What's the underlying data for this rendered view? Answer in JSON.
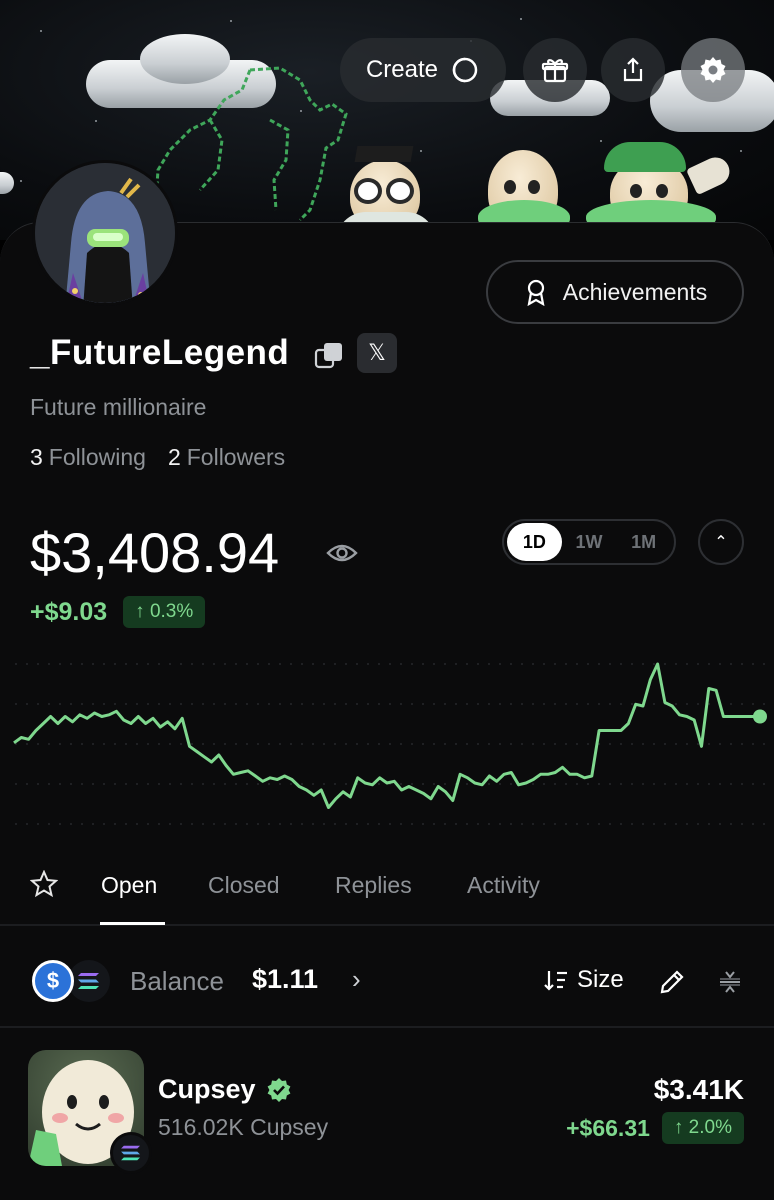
{
  "header": {
    "create_label": "Create"
  },
  "profile": {
    "username": "_FutureLegend",
    "bio": "Future millionaire",
    "following_count": "3",
    "following_label": "Following",
    "followers_count": "2",
    "followers_label": "Followers",
    "achievements_label": "Achievements",
    "x_badge": "𝕏"
  },
  "portfolio": {
    "value": "$3,408.94",
    "change_amount": "+$9.03",
    "change_percent": "↑ 0.3%",
    "ranges": [
      "1D",
      "1W",
      "1M"
    ],
    "active_range": "1D",
    "collapse_icon": "⌃"
  },
  "chart_data": {
    "type": "line",
    "title": "",
    "xlabel": "",
    "ylabel": "",
    "ylim": [
      0,
      100
    ],
    "values": [
      47,
      50,
      49,
      54,
      58,
      62,
      58,
      62,
      59,
      63,
      61,
      64,
      62,
      63,
      65,
      60,
      58,
      62,
      58,
      61,
      56,
      59,
      55,
      61,
      45,
      42,
      39,
      36,
      40,
      34,
      29,
      30,
      31,
      28,
      25,
      27,
      26,
      28,
      26,
      22,
      20,
      17,
      20,
      10,
      15,
      19,
      16,
      27,
      24,
      23,
      27,
      24,
      25,
      20,
      22,
      20,
      18,
      15,
      22,
      19,
      14,
      29,
      27,
      24,
      23,
      28,
      25,
      29,
      30,
      23,
      24,
      26,
      29,
      29,
      30,
      33,
      29,
      29,
      27,
      28,
      54,
      54,
      54,
      54,
      58,
      69,
      68,
      83,
      92,
      70,
      68,
      63,
      62,
      60,
      45,
      78,
      77,
      62,
      62,
      62,
      62,
      62,
      62
    ],
    "series": [
      {
        "values": []
      }
    ],
    "accent_color": "#7fd88e"
  },
  "tabs": [
    {
      "label": "Open",
      "active": true
    },
    {
      "label": "Closed",
      "active": false
    },
    {
      "label": "Replies",
      "active": false
    },
    {
      "label": "Activity",
      "active": false
    }
  ],
  "balance_row": {
    "label": "Balance",
    "value": "$1.11",
    "chevron": "›",
    "sort_label": "Size",
    "usdc_symbol": "$"
  },
  "holdings": [
    {
      "name": "Cupsey",
      "amount": "516.02K Cupsey",
      "value": "$3.41K",
      "change_amount": "+$66.31",
      "change_percent": "↑ 2.0%"
    }
  ],
  "colors": {
    "accent_green": "#7fd88e",
    "background": "#0b0b0c",
    "muted_text": "#8e9297",
    "usdc_blue": "#2b72d8"
  }
}
